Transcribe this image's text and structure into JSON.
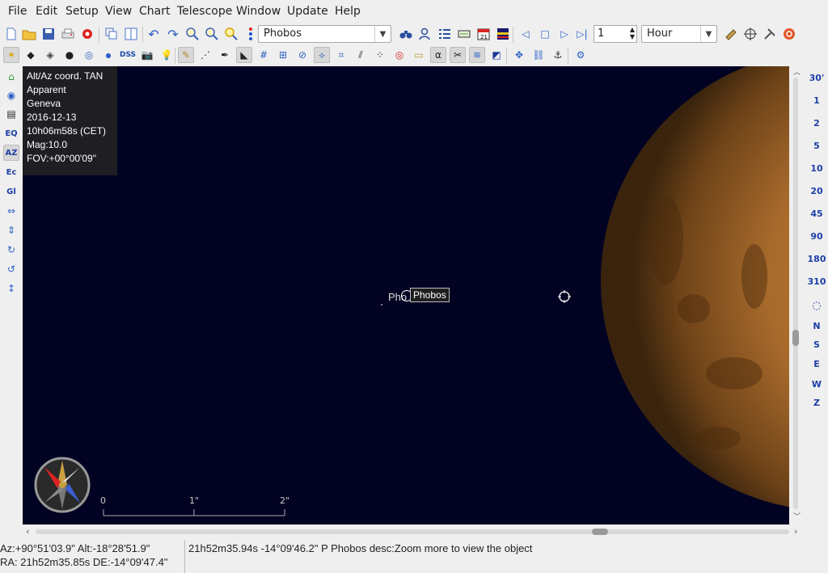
{
  "menu": [
    "File",
    "Edit",
    "Setup",
    "View",
    "Chart",
    "Telescope",
    "Window",
    "Update",
    "Help"
  ],
  "toolbar": {
    "object_search_value": "Phobos",
    "step_value": "1",
    "time_unit": "Hour",
    "dss_label": "DSS",
    "alpha_label": "α"
  },
  "leftbar": {
    "eq_label": "EQ",
    "az_label": "AZ",
    "ec_label": "Ec",
    "gl_label": "Gl"
  },
  "rightbar": {
    "fov_buttons": [
      "30'",
      "1",
      "2",
      "5",
      "10",
      "20",
      "45",
      "90",
      "180",
      "310"
    ],
    "direction_buttons": [
      "N",
      "S",
      "E",
      "W",
      "Z"
    ]
  },
  "info_panel": {
    "line1": "Alt/Az coord. TAN",
    "line2": "Apparent",
    "line3": "Geneva",
    "line4": "2016-12-13",
    "line5": "10h06m58s (CET)",
    "line6": "Mag:10.0",
    "line7": "FOV:+00°00'09\""
  },
  "sky": {
    "object_label": "Phobos",
    "object_label_partial": "Pho",
    "tooltip": "Phobos",
    "scale": {
      "labels": [
        "0",
        "1\"",
        "2\""
      ]
    }
  },
  "status": {
    "azalt": "Az:+90°51'03.9\" Alt:-18°28'51.9\"",
    "radec": "RA: 21h52m35.85s DE:-14°09'47.4\"",
    "object_info": "21h52m35.94s -14°09'46.2\" P Phobos desc:Zoom more to view the object"
  },
  "colors": {
    "sky": "#020322",
    "planet": "#b5782e",
    "dir_blue": "#1c3fa6"
  }
}
